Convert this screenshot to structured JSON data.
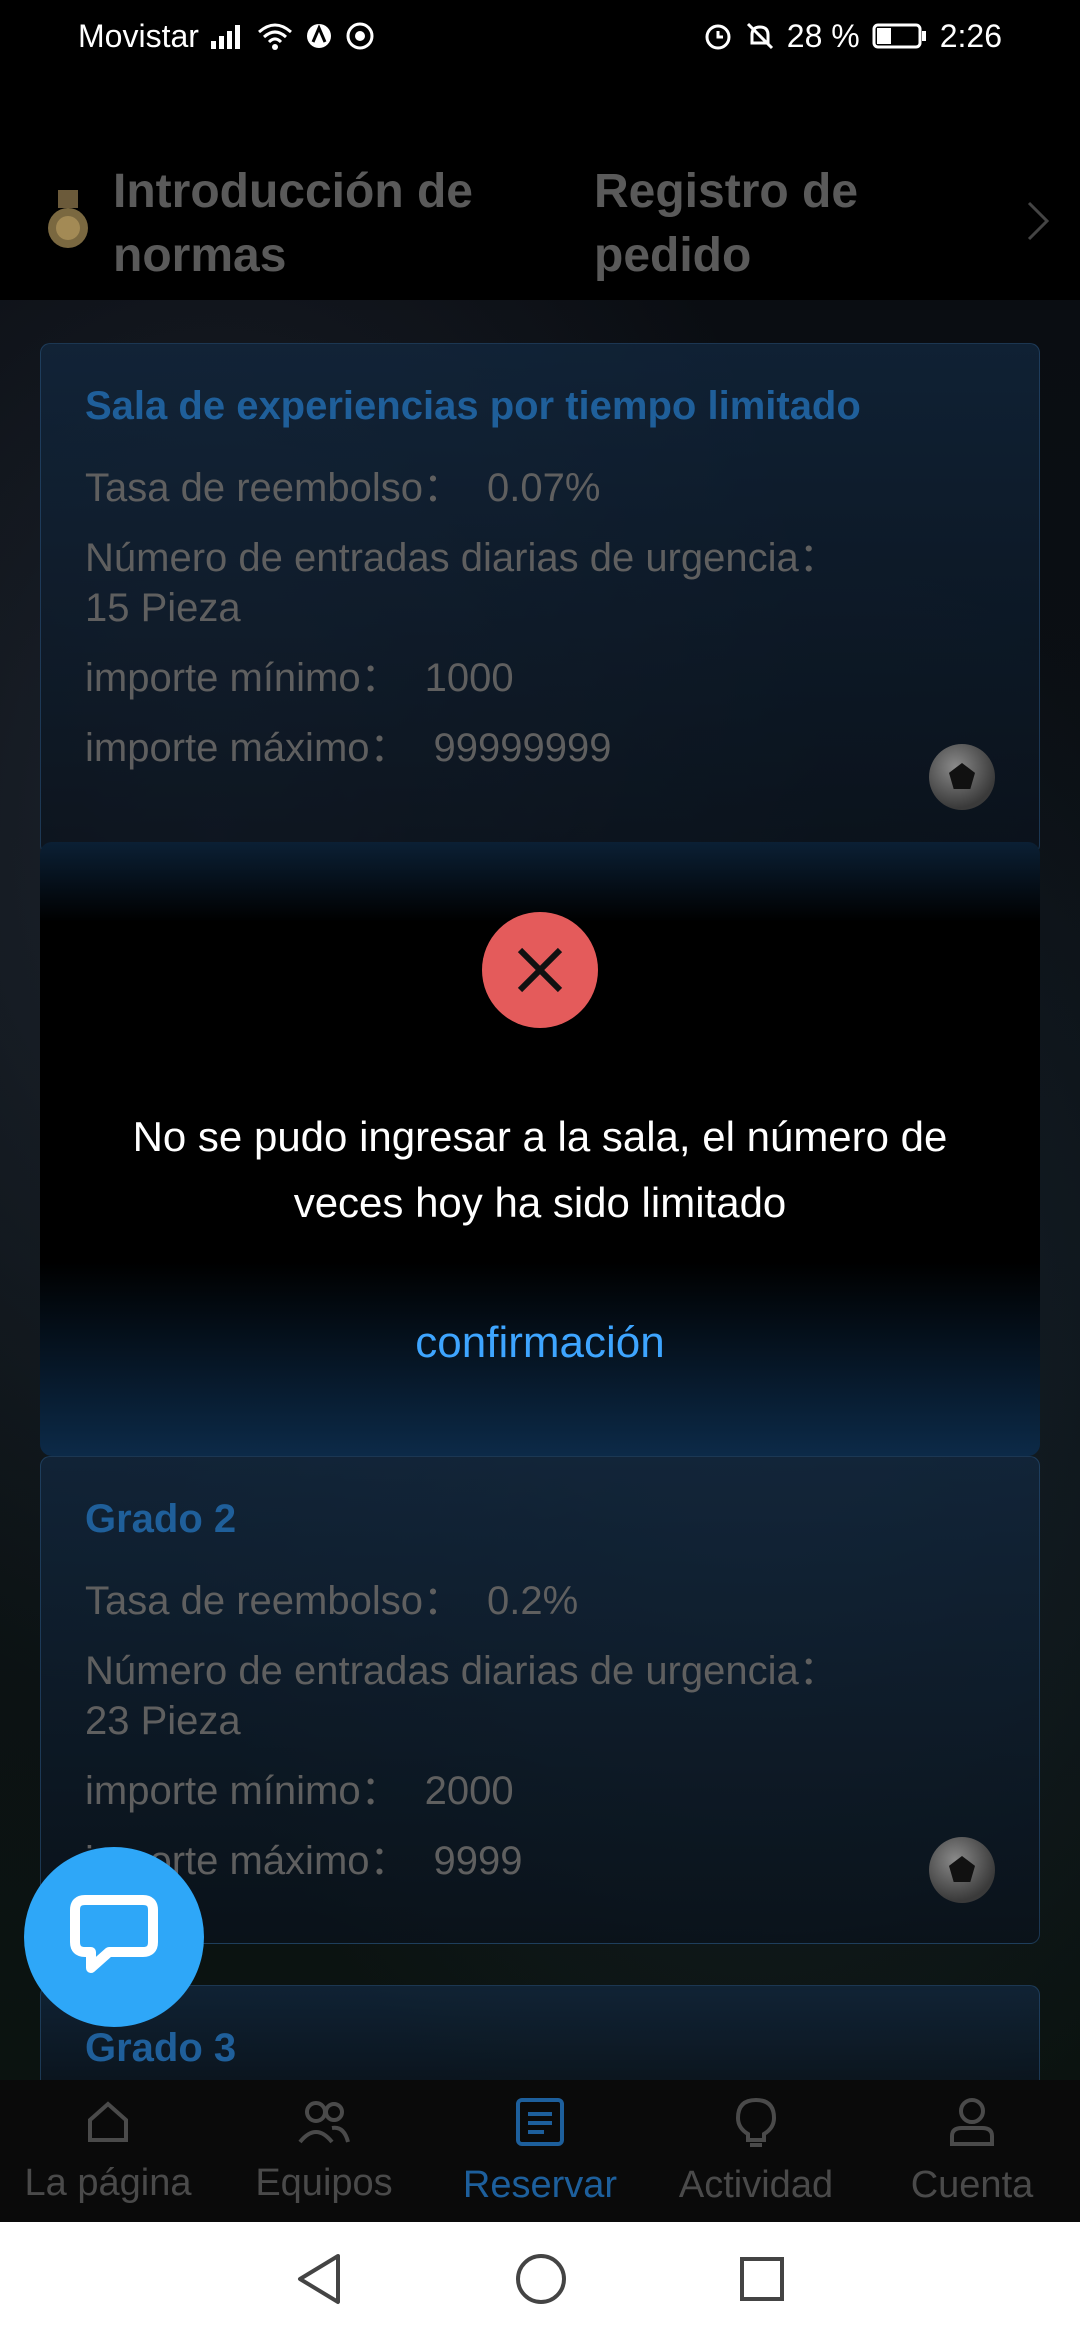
{
  "status_bar": {
    "carrier": "Movistar",
    "battery": "28 %",
    "time": "2:26"
  },
  "top_tabs": [
    {
      "label": "Introducción de normas"
    },
    {
      "label": "Registro de pedido"
    }
  ],
  "cards": [
    {
      "title": "Sala de experiencias por tiempo limitado",
      "rows": [
        {
          "key": "Tasa de reembolso：",
          "value": "0.07%"
        },
        {
          "key": "Número de entradas diarias de urgencia：",
          "value": "15 Pieza"
        },
        {
          "key": "importe mínimo：",
          "value": "1000"
        },
        {
          "key": "importe máximo：",
          "value": "99999999"
        }
      ]
    },
    {
      "title": "Grado 2",
      "rows": [
        {
          "key": "Tasa de reembolso：",
          "value": "0.2%"
        },
        {
          "key": "Número de entradas diarias de urgencia：",
          "value": "23 Pieza"
        },
        {
          "key": "importe mínimo：",
          "value": "2000"
        },
        {
          "key": "importe máximo：",
          "value": "9999"
        }
      ]
    },
    {
      "title": "Grado 3"
    }
  ],
  "dialog": {
    "message": "No se pudo ingresar a la sala, el número de veces hoy ha sido limitado",
    "confirm_label": "confirmación",
    "icon": "close-icon"
  },
  "bottom_nav": [
    {
      "label": "La página",
      "icon": "home-icon"
    },
    {
      "label": "Equipos",
      "icon": "team-icon"
    },
    {
      "label": "Reservar",
      "icon": "list-icon",
      "active": true
    },
    {
      "label": "Actividad",
      "icon": "bulb-icon"
    },
    {
      "label": "Cuenta",
      "icon": "user-icon"
    }
  ],
  "colors": {
    "accent": "#3ea5ff",
    "active_nav": "#1d5f9c",
    "error": "#e45b5b",
    "fab": "#2ea7f8"
  }
}
